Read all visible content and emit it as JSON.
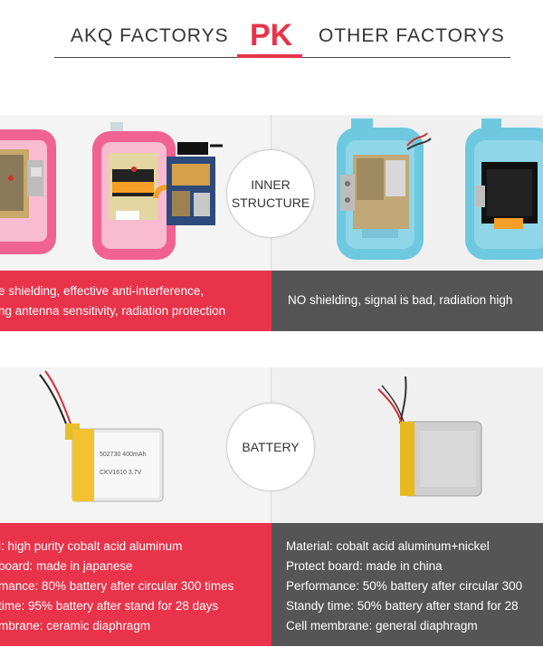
{
  "header": {
    "left_label": "AKQ FACTORYS",
    "center_label": "PK",
    "right_label": "OTHER FACTORYS"
  },
  "sections": [
    {
      "title_line1": "INNER",
      "title_line2": "STRUCTURE",
      "left_lines": [
        "e shielding, effective anti-interference,",
        "ng antenna sensitivity, radiation protection"
      ],
      "right_lines": [
        "NO shielding, signal is bad, radiation high"
      ]
    },
    {
      "title": "BATTERY",
      "battery_label_line1": "502730 400mAh",
      "battery_label_line2": "CKV1610 3.7V",
      "left_lines": [
        "l: high purity cobalt acid aluminum",
        " board: made in japanese",
        "mance: 80% battery after circular 300 times",
        "time: 95% battery after stand for 28 days",
        "mbrane: ceramic diaphragm"
      ],
      "right_lines": [
        "Material: cobalt acid aluminum+nickel",
        "Protect board: made in china",
        "Performance: 50% battery after circular 300",
        "Standy time: 50% battery after stand for 28",
        "Cell membrane: general diaphragm"
      ]
    }
  ],
  "colors": {
    "accent": "#e8334a",
    "dark_bar": "#555555",
    "pink_watch": "#f06292",
    "blue_watch": "#6ec8e0"
  }
}
